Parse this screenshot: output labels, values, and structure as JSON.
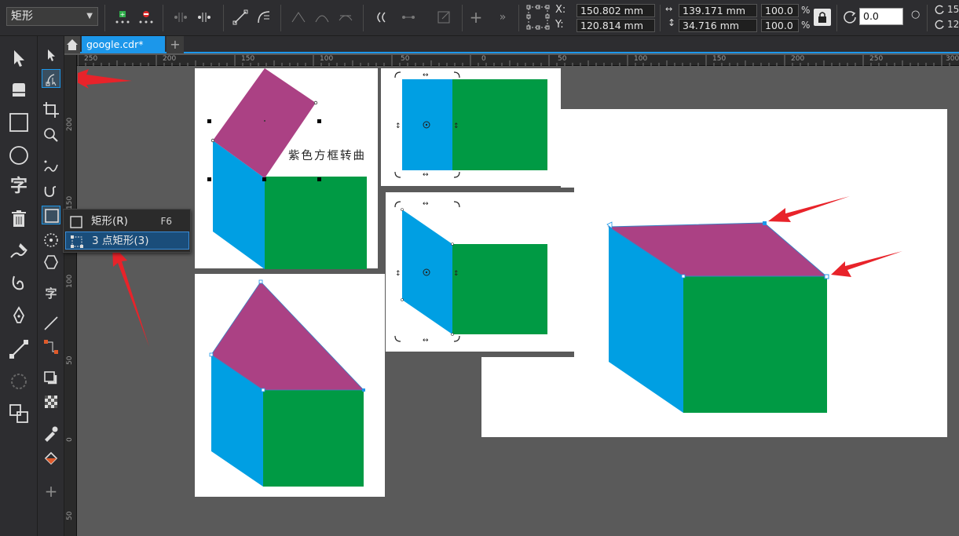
{
  "propbar": {
    "shape_type": "矩形",
    "x_label": "X:",
    "y_label": "Y:",
    "x_value": "150.802 mm",
    "y_value": "120.814 mm",
    "width_value": "139.171 mm",
    "height_value": "34.716 mm",
    "scale_w": "100.0",
    "scale_h": "100.0",
    "percent": "%",
    "rotation": "0.0",
    "partial_right": "15",
    "partial_right2": "12"
  },
  "tabs": {
    "doc_name": "google.cdr*",
    "add": "+"
  },
  "rulers": {
    "top": [
      "250",
      "200",
      "150",
      "100",
      "50",
      "0",
      "50",
      "100",
      "150",
      "200",
      "250",
      "300"
    ],
    "left": [
      "200",
      "150",
      "100",
      "50",
      "0",
      "50"
    ]
  },
  "flyout": {
    "items": [
      {
        "label": "矩形(R)",
        "shortcut": "F6"
      },
      {
        "label": "3 点矩形(3)",
        "shortcut": ""
      }
    ]
  },
  "canvas": {
    "annotation": "紫色方框转曲"
  },
  "colors": {
    "purple": "#ab4184",
    "blue": "#009fe3",
    "green": "#009a44",
    "accent": "#1c97ea",
    "arrow": "#e8232a"
  },
  "icons": {
    "toolbox": [
      "pick-tool-icon",
      "eraser-icon",
      "rectangle-icon",
      "ellipse-icon",
      "text-icon",
      "delete-icon",
      "artistic-media-icon",
      "spiral-icon",
      "pen-icon",
      "connector-icon",
      "blend-icon",
      "shape-combine-icon"
    ],
    "toolbox2": [
      "pick-icon",
      "shape-tool-icon",
      "crop-icon",
      "zoom-icon",
      "freehand-icon",
      "bspline-icon",
      "rectangle-icon",
      "ellipse-icon",
      "polygon-icon",
      "text-icon",
      "dimension-icon",
      "connector-icon",
      "drop-shadow-icon",
      "transparency-icon",
      "eyedropper-icon",
      "fill-icon",
      "add-icon"
    ]
  }
}
